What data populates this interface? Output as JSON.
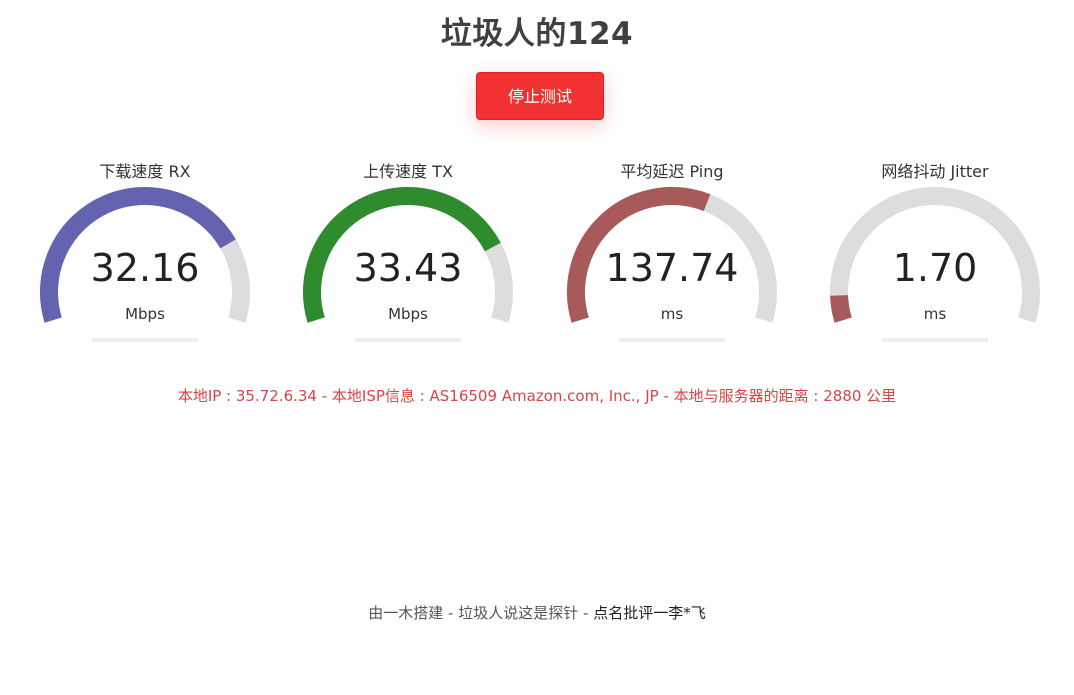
{
  "title": "垃圾人的124",
  "button": {
    "stop_label": "停止测试",
    "color": "#f23232"
  },
  "gauges": [
    {
      "label": "下载速度 RX",
      "value": "32.16",
      "unit": "Mbps",
      "fill_fraction": 0.78,
      "color": "#6363b0",
      "progress": 1.0
    },
    {
      "label": "上传速度 TX",
      "value": "33.43",
      "unit": "Mbps",
      "fill_fraction": 0.79,
      "color": "#2e8b2e",
      "progress": 0.42
    },
    {
      "label": "平均延迟 Ping",
      "value": "137.74",
      "unit": "ms",
      "fill_fraction": 0.6,
      "color": "#a85a5a",
      "progress": 1.0
    },
    {
      "label": "网络抖动 Jitter",
      "value": "1.70",
      "unit": "ms",
      "fill_fraction": 0.07,
      "color": "#a85a5a",
      "progress": 1.0
    }
  ],
  "gauge_track_color": "#dddddd",
  "info": {
    "text": "本地IP : 35.72.6.34 - 本地ISP信息 : AS16509 Amazon.com, Inc., JP - 本地与服务器的距离 : 2880 公里",
    "color": "#d64545"
  },
  "footer": {
    "part1": "由一木搭建 - 垃圾人说这是探针 - ",
    "part2": "点名批评一李*飞"
  }
}
